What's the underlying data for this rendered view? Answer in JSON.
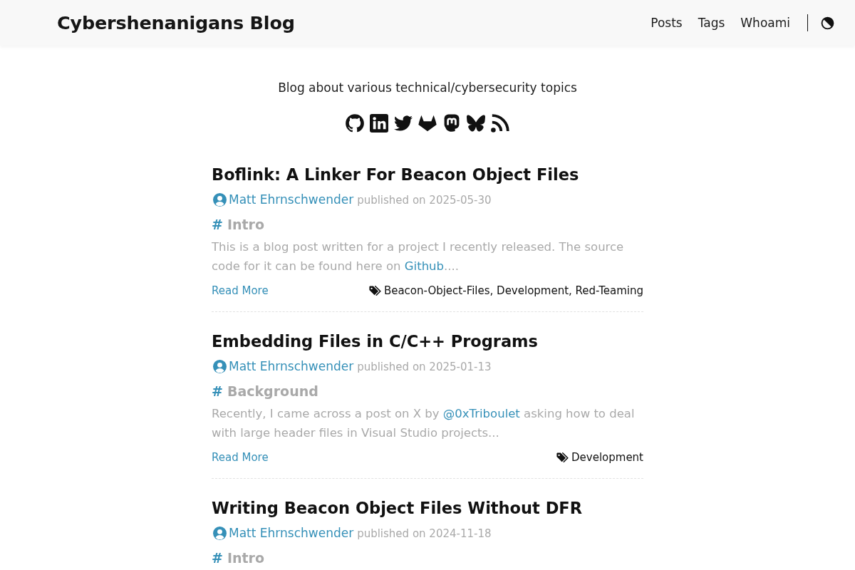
{
  "header": {
    "title": "Cybershenanigans Blog",
    "nav": [
      "Posts",
      "Tags",
      "Whoami"
    ]
  },
  "tagline": "Blog about various technical/cybersecurity topics",
  "posts": [
    {
      "title": "Boflink: A Linker For Beacon Object Files",
      "author": "Matt Ehrnschwender",
      "published": "published on 2025-05-30",
      "section": {
        "anchor": "#",
        "title": "Intro"
      },
      "summary": [
        {
          "kind": "text",
          "text": "This is a blog post written for a project I recently released. The source code for it can be found here on "
        },
        {
          "kind": "link",
          "text": "Github"
        },
        {
          "kind": "text",
          "text": "...."
        }
      ],
      "read_more": "Read More",
      "tags": "Beacon-Object-Files, Development, Red-Teaming"
    },
    {
      "title": "Embedding Files in C/C++ Programs",
      "author": "Matt Ehrnschwender",
      "published": "published on 2025-01-13",
      "section": {
        "anchor": "#",
        "title": "Background"
      },
      "summary": [
        {
          "kind": "text",
          "text": "Recently, I came across a post on X by "
        },
        {
          "kind": "link",
          "text": "@0xTriboulet"
        },
        {
          "kind": "text",
          "text": " asking how to deal with large header files in Visual Studio projects..."
        }
      ],
      "read_more": "Read More",
      "tags": "Development"
    },
    {
      "title": "Writing Beacon Object Files Without DFR",
      "author": "Matt Ehrnschwender",
      "published": "published on 2024-11-18",
      "section": {
        "anchor": "#",
        "title": "Intro"
      }
    }
  ]
}
